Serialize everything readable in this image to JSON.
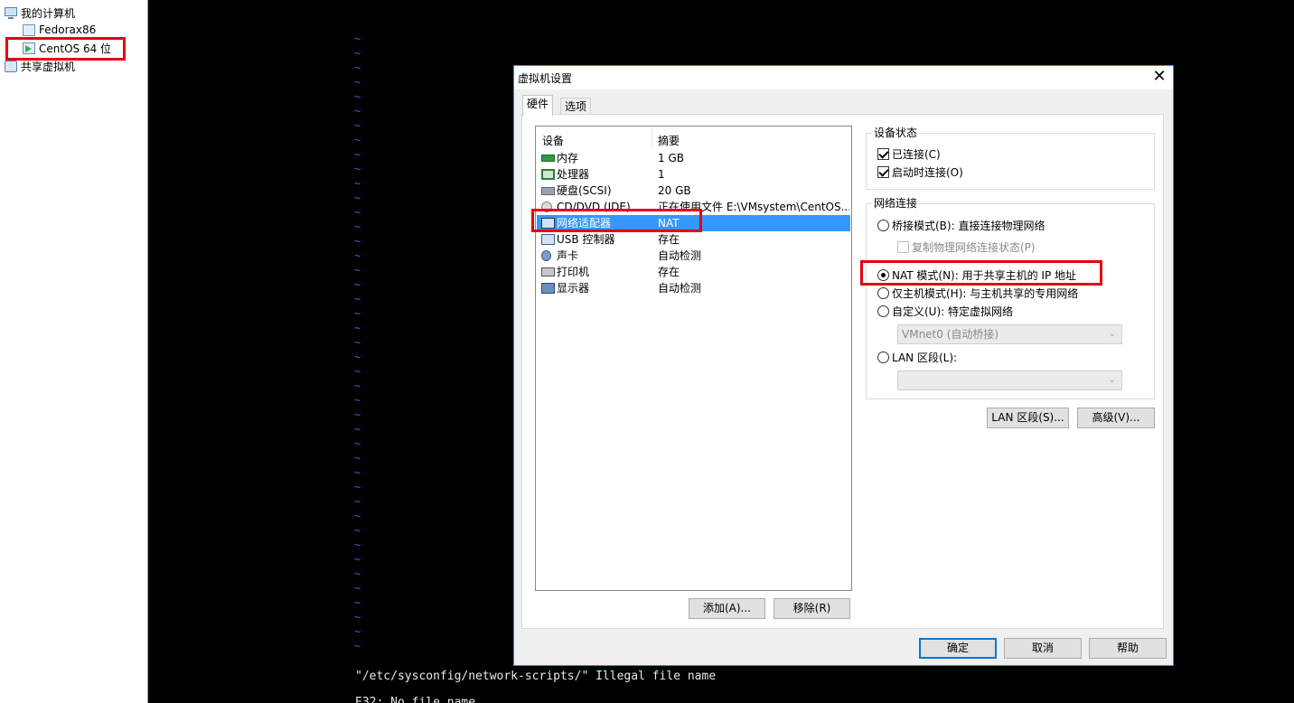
{
  "library": {
    "items": [
      {
        "label": "我的计算机"
      },
      {
        "label": "Fedorax86"
      },
      {
        "label": "CentOS 64 位"
      },
      {
        "label": "共享虚拟机"
      }
    ]
  },
  "terminal": {
    "tilde": "~",
    "message": "\"/etc/sysconfig/network-scripts/\" Illegal file name",
    "message2": "E32: No file name"
  },
  "dialog": {
    "title": "虚拟机设置",
    "close": "✕",
    "tabs": [
      {
        "label": "硬件"
      },
      {
        "label": "选项"
      }
    ],
    "device_list": {
      "headers": {
        "device": "设备",
        "summary": "摘要"
      },
      "rows": [
        {
          "name": "内存",
          "summary": "1 GB",
          "icon": "memory-icon"
        },
        {
          "name": "处理器",
          "summary": "1",
          "icon": "processor-icon"
        },
        {
          "name": "硬盘(SCSI)",
          "summary": "20 GB",
          "icon": "hard-disk-icon"
        },
        {
          "name": "CD/DVD (IDE)",
          "summary": "正在使用文件 E:\\VMsystem\\CentOS...",
          "icon": "cd-dvd-icon"
        },
        {
          "name": "网络适配器",
          "summary": "NAT",
          "icon": "network-adapter-icon",
          "selected": true
        },
        {
          "name": "USB 控制器",
          "summary": "存在",
          "icon": "usb-icon"
        },
        {
          "name": "声卡",
          "summary": "自动检测",
          "icon": "sound-card-icon"
        },
        {
          "name": "打印机",
          "summary": "存在",
          "icon": "printer-icon"
        },
        {
          "name": "显示器",
          "summary": "自动检测",
          "icon": "display-icon"
        }
      ]
    },
    "buttons": {
      "add": "添加(A)...",
      "remove": "移除(R)",
      "lan_segments": "LAN 区段(S)...",
      "advanced": "高级(V)...",
      "ok": "确定",
      "cancel": "取消",
      "help": "帮助"
    },
    "device_status": {
      "title": "设备状态",
      "connected": {
        "label": "已连接(C)",
        "checked": true
      },
      "connect_at_power_on": {
        "label": "启动时连接(O)",
        "checked": true
      }
    },
    "network_connection": {
      "title": "网络连接",
      "bridged": {
        "label": "桥接模式(B): 直接连接物理网络",
        "checked": false
      },
      "replicate": {
        "label": "复制物理网络连接状态(P)",
        "checked": false
      },
      "nat": {
        "label": "NAT 模式(N): 用于共享主机的 IP 地址",
        "checked": true
      },
      "host_only": {
        "label": "仅主机模式(H): 与主机共享的专用网络",
        "checked": false
      },
      "custom": {
        "label": "自定义(U): 特定虚拟网络",
        "checked": false
      },
      "custom_select": "VMnet0 (自动桥接)",
      "lan_segment": {
        "label": "LAN 区段(L):",
        "checked": false
      },
      "lan_select": ""
    }
  },
  "colors": {
    "highlight": "#e60012",
    "selection": "#3399ff",
    "vim_tilde": "#3f5fe8"
  }
}
